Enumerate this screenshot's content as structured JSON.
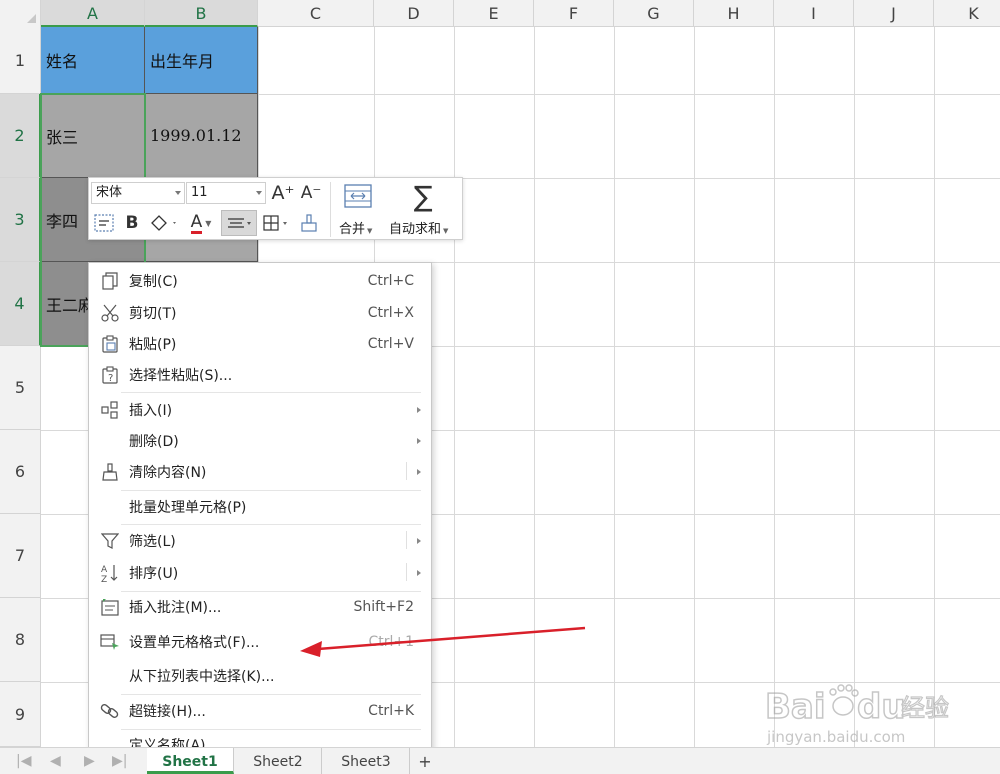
{
  "columns": [
    "A",
    "B",
    "C",
    "D",
    "E",
    "F",
    "G",
    "H",
    "I",
    "J",
    "K"
  ],
  "rows": [
    "1",
    "2",
    "3",
    "4",
    "5",
    "6",
    "7",
    "8",
    "9"
  ],
  "cells": {
    "a1": "姓名",
    "b1": "出生年月",
    "a2": "张三",
    "b2": "1999.01.12",
    "a3": "李四",
    "a4": "王二麻"
  },
  "toolbar": {
    "font_name": "宋体",
    "font_size": "11",
    "increase_font": "A⁺",
    "decrease_font": "A⁻",
    "bold": "B",
    "font_color_letter": "A",
    "merge_label": "合并",
    "autosum_label": "自动求和"
  },
  "context_menu": {
    "items": [
      {
        "label": "复制(C)",
        "shortcut": "Ctrl+C",
        "icon": "copy-icon"
      },
      {
        "label": "剪切(T)",
        "shortcut": "Ctrl+X",
        "icon": "scissors-icon"
      },
      {
        "label": "粘贴(P)",
        "shortcut": "Ctrl+V",
        "icon": "paste-icon"
      },
      {
        "label": "选择性粘贴(S)...",
        "shortcut": "",
        "icon": "paste-special-icon"
      },
      {
        "label": "插入(I)",
        "shortcut": "",
        "icon": "insert-icon"
      },
      {
        "label": "删除(D)",
        "shortcut": "",
        "icon": ""
      },
      {
        "label": "清除内容(N)",
        "shortcut": "",
        "icon": "eraser-icon"
      },
      {
        "label": "批量处理单元格(P)",
        "shortcut": "",
        "icon": ""
      },
      {
        "label": "筛选(L)",
        "shortcut": "",
        "icon": "filter-icon"
      },
      {
        "label": "排序(U)",
        "shortcut": "",
        "icon": "sort-icon"
      },
      {
        "label": "插入批注(M)...",
        "shortcut": "Shift+F2",
        "icon": "comment-icon"
      },
      {
        "label": "设置单元格格式(F)...",
        "shortcut": "Ctrl+1",
        "icon": "format-cells-icon"
      },
      {
        "label": "从下拉列表中选择(K)...",
        "shortcut": "",
        "icon": ""
      },
      {
        "label": "超链接(H)...",
        "shortcut": "Ctrl+K",
        "icon": "link-icon"
      },
      {
        "label": "定义名称(A)...",
        "shortcut": "",
        "icon": ""
      }
    ]
  },
  "sheets": [
    "Sheet1",
    "Sheet2",
    "Sheet3"
  ],
  "add_sheet": "+",
  "watermark": {
    "brand": "Baidu经验",
    "url": "jingyan.baidu.com"
  },
  "colors": {
    "header_fill": "#5aa0dc",
    "data_fill": "#a6a6a6",
    "selection": "#4aa35a",
    "annotation_arrow": "#d9202a"
  }
}
